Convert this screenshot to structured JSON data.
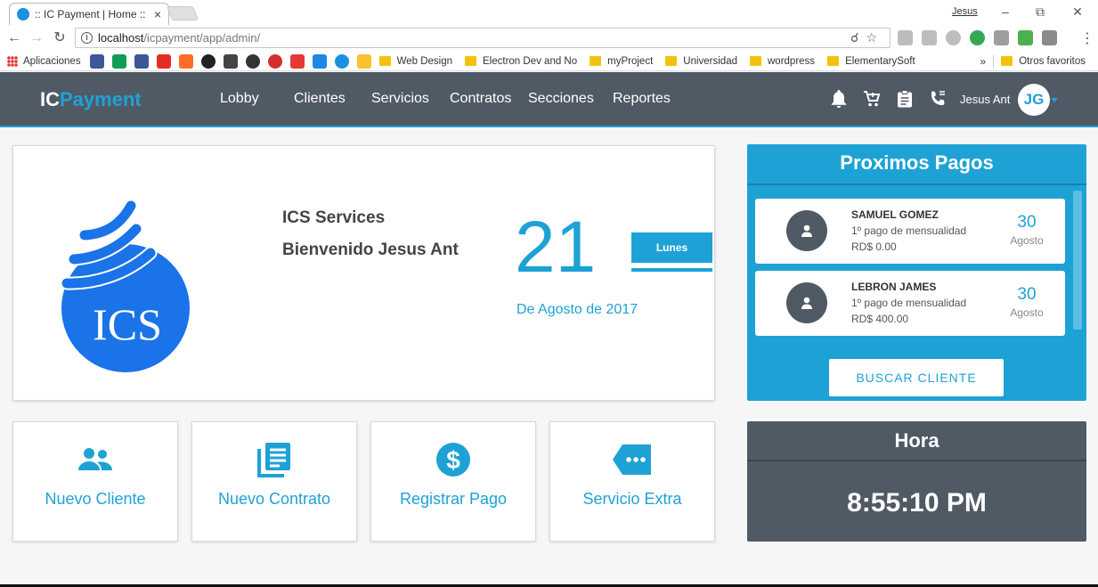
{
  "browser": {
    "tab_title": ":: IC Payment | Home ::",
    "tab_close": "×",
    "profile_name": "Jesus",
    "url_host": "localhost",
    "url_path": "/icpayment/app/admin/",
    "bookmarks": {
      "apps_label": "Aplicaciones",
      "folders": [
        "Web Design",
        "Electron Dev and No",
        "myProject",
        "Universidad",
        "wordpress",
        "ElementarySoft"
      ],
      "more": "»",
      "other": "Otros favoritos"
    }
  },
  "navbar": {
    "brand_prefix": "IC",
    "brand_suffix": "Payment",
    "links": [
      "Lobby",
      "Clientes",
      "Servicios",
      "Contratos",
      "Secciones",
      "Reportes"
    ],
    "user_name": "Jesus Ant",
    "user_initials": "JG"
  },
  "welcome": {
    "logo_text": "ICS",
    "company": "ICS Services",
    "greeting": "Bienvenido Jesus Ant",
    "day": "21",
    "weekday": "Lunes",
    "date_text": "De Agosto de 2017"
  },
  "actions": [
    {
      "label": "Nuevo Cliente",
      "icon": "users-icon"
    },
    {
      "label": "Nuevo Contrato",
      "icon": "document-icon"
    },
    {
      "label": "Registrar Pago",
      "icon": "dollar-icon"
    },
    {
      "label": "Servicio Extra",
      "icon": "tag-icon"
    }
  ],
  "payments": {
    "title": "Proximos Pagos",
    "items": [
      {
        "name": "SAMUEL GOMEZ",
        "desc": "1º pago de mensualidad",
        "amount": "RD$ 0.00",
        "day": "30",
        "month": "Agosto"
      },
      {
        "name": "LEBRON JAMES",
        "desc": "1º pago de mensualidad",
        "amount": "RD$ 400.00",
        "day": "30",
        "month": "Agosto"
      }
    ],
    "search_button": "BUSCAR CLIENTE"
  },
  "clock": {
    "title": "Hora",
    "time": "8:55:10 PM"
  },
  "colors": {
    "accent": "#1ea2d6",
    "navbar": "#505a65",
    "logo_blue": "#1a73e8"
  }
}
